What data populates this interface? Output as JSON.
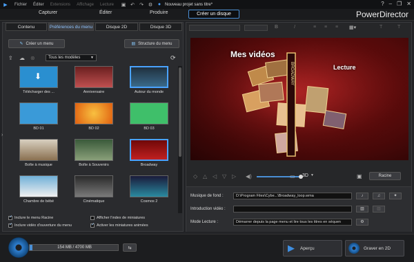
{
  "titlebar": {
    "menus": [
      "Fichier",
      "Éditer",
      "Extensions",
      "Affichage",
      "Lecture"
    ],
    "project_title": "Nouveau projet sans titre*",
    "window_controls": [
      "?",
      "–",
      "❐",
      "✕"
    ]
  },
  "modes": {
    "capturer": "Capturer",
    "editer": "Éditer",
    "produire": "Produire",
    "creer_disque": "Créer un disque"
  },
  "brand": "PowerDirector",
  "left": {
    "tabs": [
      "Contenu",
      "Préférences du menu",
      "Disque 2D",
      "Disque 3D"
    ],
    "create_menu": "Créer un menu",
    "menu_structure": "Structure du menu",
    "filter": "Tous les modèles",
    "templates": [
      {
        "label": "Télécharger des ...",
        "selected": false
      },
      {
        "label": "Anniversaire",
        "selected": false
      },
      {
        "label": "Autour du monde",
        "selected": true
      },
      {
        "label": "BD 01",
        "selected": false
      },
      {
        "label": "BD 02",
        "selected": false
      },
      {
        "label": "BD 03",
        "selected": false
      },
      {
        "label": "Boîte à musique",
        "selected": false
      },
      {
        "label": "Boîte à Souvenirs",
        "selected": false
      },
      {
        "label": "Broadway",
        "selected": true
      },
      {
        "label": "Chambre de bébé",
        "selected": false
      },
      {
        "label": "Cinématique",
        "selected": false
      },
      {
        "label": "Cosmos 2",
        "selected": false
      }
    ],
    "options": {
      "root_menu": "Inclure le menu Racine",
      "opening_video": "Inclure vidéo d'ouverture du menu",
      "thumb_index": "Afficher l'index de miniatures",
      "animated_thumbs": "Activer les miniatures animées"
    }
  },
  "preview": {
    "title": "Mes vidéos",
    "play": "Lecture",
    "broadway_marquee": "BROADWAY",
    "mode_3d": "3D",
    "root_button": "Racine"
  },
  "settings": {
    "music_label": "Musique de fond :",
    "music_value": "D:\\Program Files\\Cybe...\\Broadway_loop.wma",
    "intro_label": "Introduction vidéo :",
    "intro_value": "",
    "playback_label": "Mode Lecture :",
    "playback_value": "Démarrer depuis la page menu et lire tous les titres en séquen"
  },
  "bottom": {
    "capacity": "154 MB / 4700 MB",
    "preview": "Aperçu",
    "burn": "Graver en 2D"
  },
  "colors": {
    "accent": "#4a8fd6",
    "preview_bg": "#7a0f10"
  }
}
